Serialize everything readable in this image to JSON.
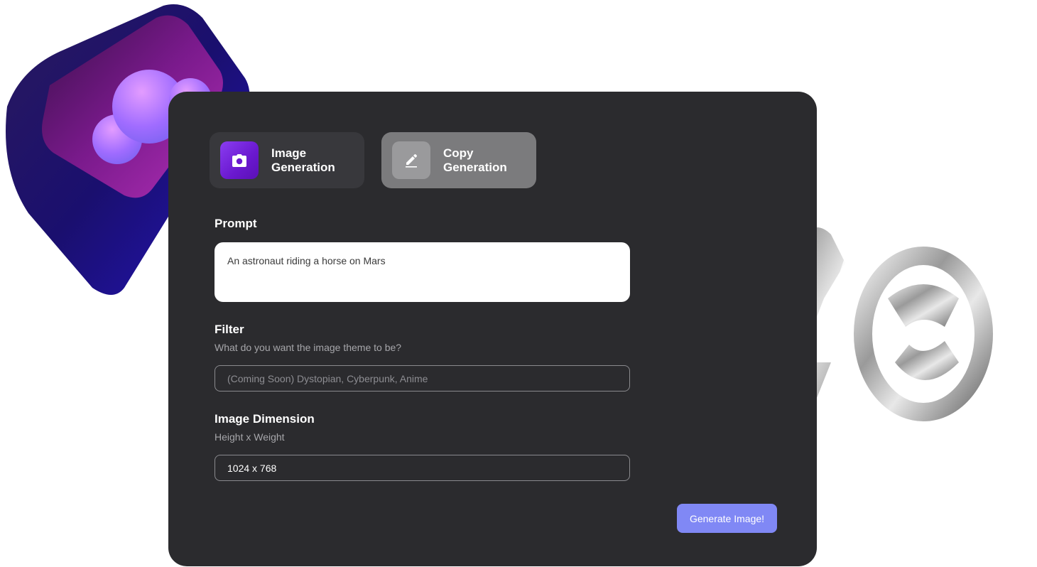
{
  "tabs": {
    "image": {
      "label": "Image Generation",
      "icon": "camera-icon"
    },
    "copy": {
      "label": "Copy Generation",
      "icon": "pencil-icon"
    }
  },
  "prompt": {
    "label": "Prompt",
    "value": "An astronaut riding a horse on Mars"
  },
  "filter": {
    "label": "Filter",
    "hint": "What do you want the image theme to be?",
    "placeholder": "(Coming Soon) Dystopian, Cyberpunk, Anime"
  },
  "dimension": {
    "label": "Image Dimension",
    "hint": "Height x Weight",
    "value": "1024 x 768"
  },
  "generate_button": {
    "label": "Generate Image!"
  },
  "colors": {
    "panel": "#2b2b2e",
    "accent_purple": "#7b2fe0",
    "button": "#8088f5"
  }
}
